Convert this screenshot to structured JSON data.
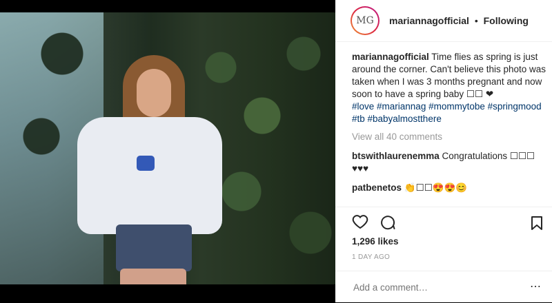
{
  "post": {
    "username": "mariannagofficial",
    "follow_state": "Following",
    "avatar_initials": "MG",
    "caption": "Time flies as spring is just around the corner. Can't believe this photo was taken when I was 3 months pregnant and now soon to have a spring baby ☐☐ ❤",
    "hashtags": "#love #mariannag #mommytobe #springmood #tb #babyalmostthere",
    "view_all_comments": "View all 40 comments",
    "comments": [
      {
        "user": "btswithlaurenemma",
        "text": "Congratulations ☐☐☐ ♥♥♥"
      },
      {
        "user": "patbenetos",
        "text": "👏☐☐😍😍😊"
      }
    ],
    "likes": "1,296 likes",
    "time_ago": "1 DAY AGO",
    "add_comment_placeholder": "Add a comment…",
    "more_icon": "⋯"
  },
  "icons": [
    "heart-icon",
    "comment-icon",
    "bookmark-icon",
    "more-icon"
  ]
}
